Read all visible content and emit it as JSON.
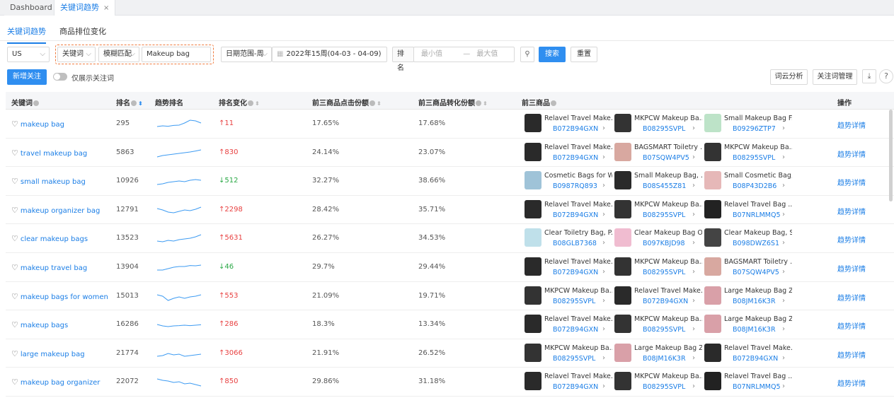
{
  "window_tabs": [
    {
      "label": "Dashboard"
    },
    {
      "label": "关键词趋势",
      "close": "×"
    }
  ],
  "sub_tabs": [
    "关键词趋势",
    "商品排位变化"
  ],
  "filters": {
    "marketplace": "US",
    "field": "关键词",
    "match": "模糊匹配",
    "keyword_value": "Makeup bag",
    "date_range_type": "日期范围-周",
    "date_value": "2022年15周(04-03 - 04-09)",
    "rank_label": "排名",
    "min_placeholder": "最小值",
    "range_sep": "—",
    "max_placeholder": "最大值",
    "search_label": "搜索",
    "reset_label": "重置"
  },
  "toolbar": {
    "add_follow_label": "新增关注",
    "only_show_followed_label": "仅展示关注词",
    "word_cloud_label": "词云分析",
    "follow_manage_label": "关注词管理",
    "download_icon": "⤓",
    "help_icon": "?"
  },
  "columns": [
    "关键词",
    "排名",
    "趋势排名",
    "排名变化",
    "前三商品点击份额",
    "前三商品转化份额",
    "前三商品",
    "操作"
  ],
  "rows": [
    {
      "keyword": "makeup bag",
      "rank": "295",
      "change": "↑11",
      "dir": "up",
      "click": "17.65%",
      "conv": "17.68%",
      "trend": [
        0.3,
        0.35,
        0.32,
        0.38,
        0.4,
        0.55,
        0.75,
        0.7,
        0.55
      ],
      "products": [
        {
          "title": "Relavel Travel Make...",
          "asin": "B072B94GXN",
          "color": "#2a2a2a"
        },
        {
          "title": "MKPCW Makeup Ba...",
          "asin": "B08295SVPL",
          "color": "#333"
        },
        {
          "title": "Small Makeup Bag F...",
          "asin": "B09296ZTP7",
          "color": "#bde3c8"
        }
      ],
      "op": "趋势详情"
    },
    {
      "keyword": "travel makeup bag",
      "rank": "5863",
      "change": "↑830",
      "dir": "up",
      "click": "24.14%",
      "conv": "23.07%",
      "trend": [
        0.2,
        0.3,
        0.35,
        0.4,
        0.45,
        0.5,
        0.55,
        0.62,
        0.7
      ],
      "products": [
        {
          "title": "Relavel Travel Make...",
          "asin": "B072B94GXN",
          "color": "#2a2a2a"
        },
        {
          "title": "BAGSMART Toiletry ...",
          "asin": "B07SQW4PV5",
          "color": "#d8a8a0"
        },
        {
          "title": "MKPCW Makeup Ba...",
          "asin": "B08295SVPL",
          "color": "#333"
        }
      ],
      "op": "趋势详情"
    },
    {
      "keyword": "small makeup bag",
      "rank": "10926",
      "change": "↓512",
      "dir": "down",
      "click": "32.27%",
      "conv": "38.66%",
      "trend": [
        0.25,
        0.3,
        0.4,
        0.45,
        0.5,
        0.45,
        0.55,
        0.6,
        0.55
      ],
      "products": [
        {
          "title": "Cosmetic Bags for W...",
          "asin": "B0987RQ893",
          "color": "#9fc3d8"
        },
        {
          "title": "Small Makeup Bag, ...",
          "asin": "B08S455Z81",
          "color": "#2a2a2a"
        },
        {
          "title": "Small Cosmetic Bag,...",
          "asin": "B08P43D2B6",
          "color": "#e6b8b8"
        }
      ],
      "op": "趋势详情"
    },
    {
      "keyword": "makeup organizer bag",
      "rank": "12791",
      "change": "↑2298",
      "dir": "up",
      "click": "28.42%",
      "conv": "35.71%",
      "trend": [
        0.6,
        0.5,
        0.35,
        0.3,
        0.4,
        0.5,
        0.45,
        0.55,
        0.7
      ],
      "products": [
        {
          "title": "Relavel Travel Make...",
          "asin": "B072B94GXN",
          "color": "#2a2a2a"
        },
        {
          "title": "MKPCW Makeup Ba...",
          "asin": "B08295SVPL",
          "color": "#333"
        },
        {
          "title": "Relavel Travel Bag ...",
          "asin": "B07NRLMMQ5",
          "color": "#222"
        }
      ],
      "op": "趋势详情"
    },
    {
      "keyword": "clear makeup bags",
      "rank": "13523",
      "change": "↑5631",
      "dir": "up",
      "click": "26.27%",
      "conv": "34.53%",
      "trend": [
        0.3,
        0.25,
        0.35,
        0.3,
        0.4,
        0.45,
        0.5,
        0.6,
        0.75
      ],
      "products": [
        {
          "title": "Clear Toiletry Bag, P...",
          "asin": "B08GLB7368",
          "color": "#bfe0ea"
        },
        {
          "title": "Clear Makeup Bag O...",
          "asin": "B097KBJD98",
          "color": "#f0bcd0"
        },
        {
          "title": "Clear Makeup Bag, S...",
          "asin": "B098DWZ6S1",
          "color": "#444"
        }
      ],
      "op": "趋势详情"
    },
    {
      "keyword": "makeup travel bag",
      "rank": "13904",
      "change": "↓46",
      "dir": "down",
      "click": "29.7%",
      "conv": "29.44%",
      "trend": [
        0.3,
        0.3,
        0.4,
        0.5,
        0.55,
        0.55,
        0.62,
        0.6,
        0.65
      ],
      "products": [
        {
          "title": "Relavel Travel Make...",
          "asin": "B072B94GXN",
          "color": "#2a2a2a"
        },
        {
          "title": "MKPCW Makeup Ba...",
          "asin": "B08295SVPL",
          "color": "#333"
        },
        {
          "title": "BAGSMART Toiletry ...",
          "asin": "B07SQW4PV5",
          "color": "#d8a8a0"
        }
      ],
      "op": "趋势详情"
    },
    {
      "keyword": "makeup bags for women",
      "rank": "15013",
      "change": "↑553",
      "dir": "up",
      "click": "21.09%",
      "conv": "19.71%",
      "trend": [
        0.6,
        0.5,
        0.2,
        0.35,
        0.45,
        0.35,
        0.45,
        0.5,
        0.6
      ],
      "products": [
        {
          "title": "MKPCW Makeup Ba...",
          "asin": "B08295SVPL",
          "color": "#333"
        },
        {
          "title": "Relavel Travel Make...",
          "asin": "B072B94GXN",
          "color": "#2a2a2a"
        },
        {
          "title": "Large Makeup Bag Z...",
          "asin": "B08JM16K3R",
          "color": "#d9a0a8"
        }
      ],
      "op": "趋势详情"
    },
    {
      "keyword": "makeup bags",
      "rank": "16286",
      "change": "↑286",
      "dir": "up",
      "click": "18.3%",
      "conv": "13.34%",
      "trend": [
        0.5,
        0.4,
        0.35,
        0.4,
        0.42,
        0.45,
        0.42,
        0.45,
        0.48
      ],
      "products": [
        {
          "title": "Relavel Travel Make...",
          "asin": "B072B94GXN",
          "color": "#2a2a2a"
        },
        {
          "title": "MKPCW Makeup Ba...",
          "asin": "B08295SVPL",
          "color": "#333"
        },
        {
          "title": "Large Makeup Bag Z...",
          "asin": "B08JM16K3R",
          "color": "#d9a0a8"
        }
      ],
      "op": "趋势详情"
    },
    {
      "keyword": "large makeup bag",
      "rank": "21774",
      "change": "↑3066",
      "dir": "up",
      "click": "21.91%",
      "conv": "26.52%",
      "trend": [
        0.3,
        0.35,
        0.5,
        0.4,
        0.45,
        0.3,
        0.35,
        0.4,
        0.45
      ],
      "products": [
        {
          "title": "MKPCW Makeup Ba...",
          "asin": "B08295SVPL",
          "color": "#333"
        },
        {
          "title": "Large Makeup Bag Z...",
          "asin": "B08JM16K3R",
          "color": "#d9a0a8"
        },
        {
          "title": "Relavel Travel Make...",
          "asin": "B072B94GXN",
          "color": "#2a2a2a"
        }
      ],
      "op": "趋势详情"
    },
    {
      "keyword": "makeup bag organizer",
      "rank": "22072",
      "change": "↑850",
      "dir": "up",
      "click": "29.86%",
      "conv": "31.18%",
      "trend": [
        0.7,
        0.6,
        0.55,
        0.45,
        0.5,
        0.35,
        0.4,
        0.3,
        0.2
      ],
      "products": [
        {
          "title": "Relavel Travel Make...",
          "asin": "B072B94GXN",
          "color": "#2a2a2a"
        },
        {
          "title": "MKPCW Makeup Ba...",
          "asin": "B08295SVPL",
          "color": "#333"
        },
        {
          "title": "Relavel Travel Bag ...",
          "asin": "B07NRLMMQ5",
          "color": "#222"
        }
      ],
      "op": "趋势详情"
    }
  ],
  "colors": {
    "accent": "#2f8ef0",
    "up": "#e84141",
    "down": "#29a845",
    "highlight": "#f07b3f"
  }
}
